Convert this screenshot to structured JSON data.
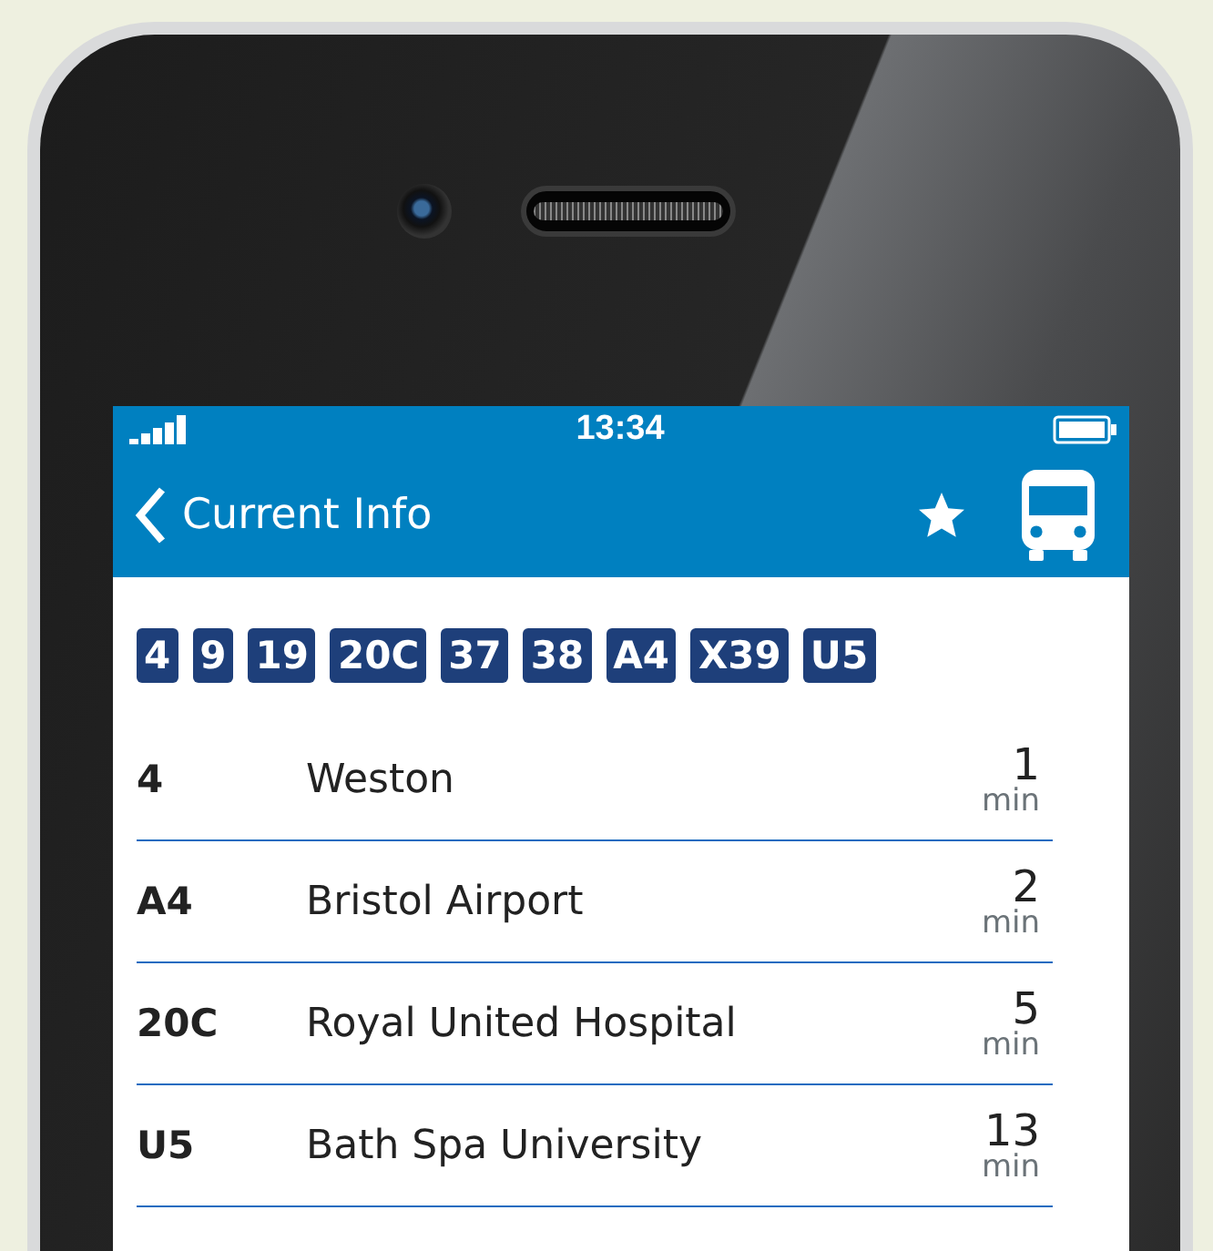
{
  "status_bar": {
    "time": "13:34"
  },
  "nav": {
    "back_label": "Current Info"
  },
  "route_chips": [
    "4",
    "9",
    "19",
    "20C",
    "37",
    "38",
    "A4",
    "X39",
    "U5"
  ],
  "departures": [
    {
      "route": "4",
      "destination": "Weston",
      "time": "1",
      "unit": "min"
    },
    {
      "route": "A4",
      "destination": "Bristol Airport",
      "time": "2",
      "unit": "min"
    },
    {
      "route": "20C",
      "destination": "Royal United Hospital",
      "time": "5",
      "unit": "min"
    },
    {
      "route": "U5",
      "destination": "Bath Spa University",
      "time": "13",
      "unit": "min"
    }
  ]
}
